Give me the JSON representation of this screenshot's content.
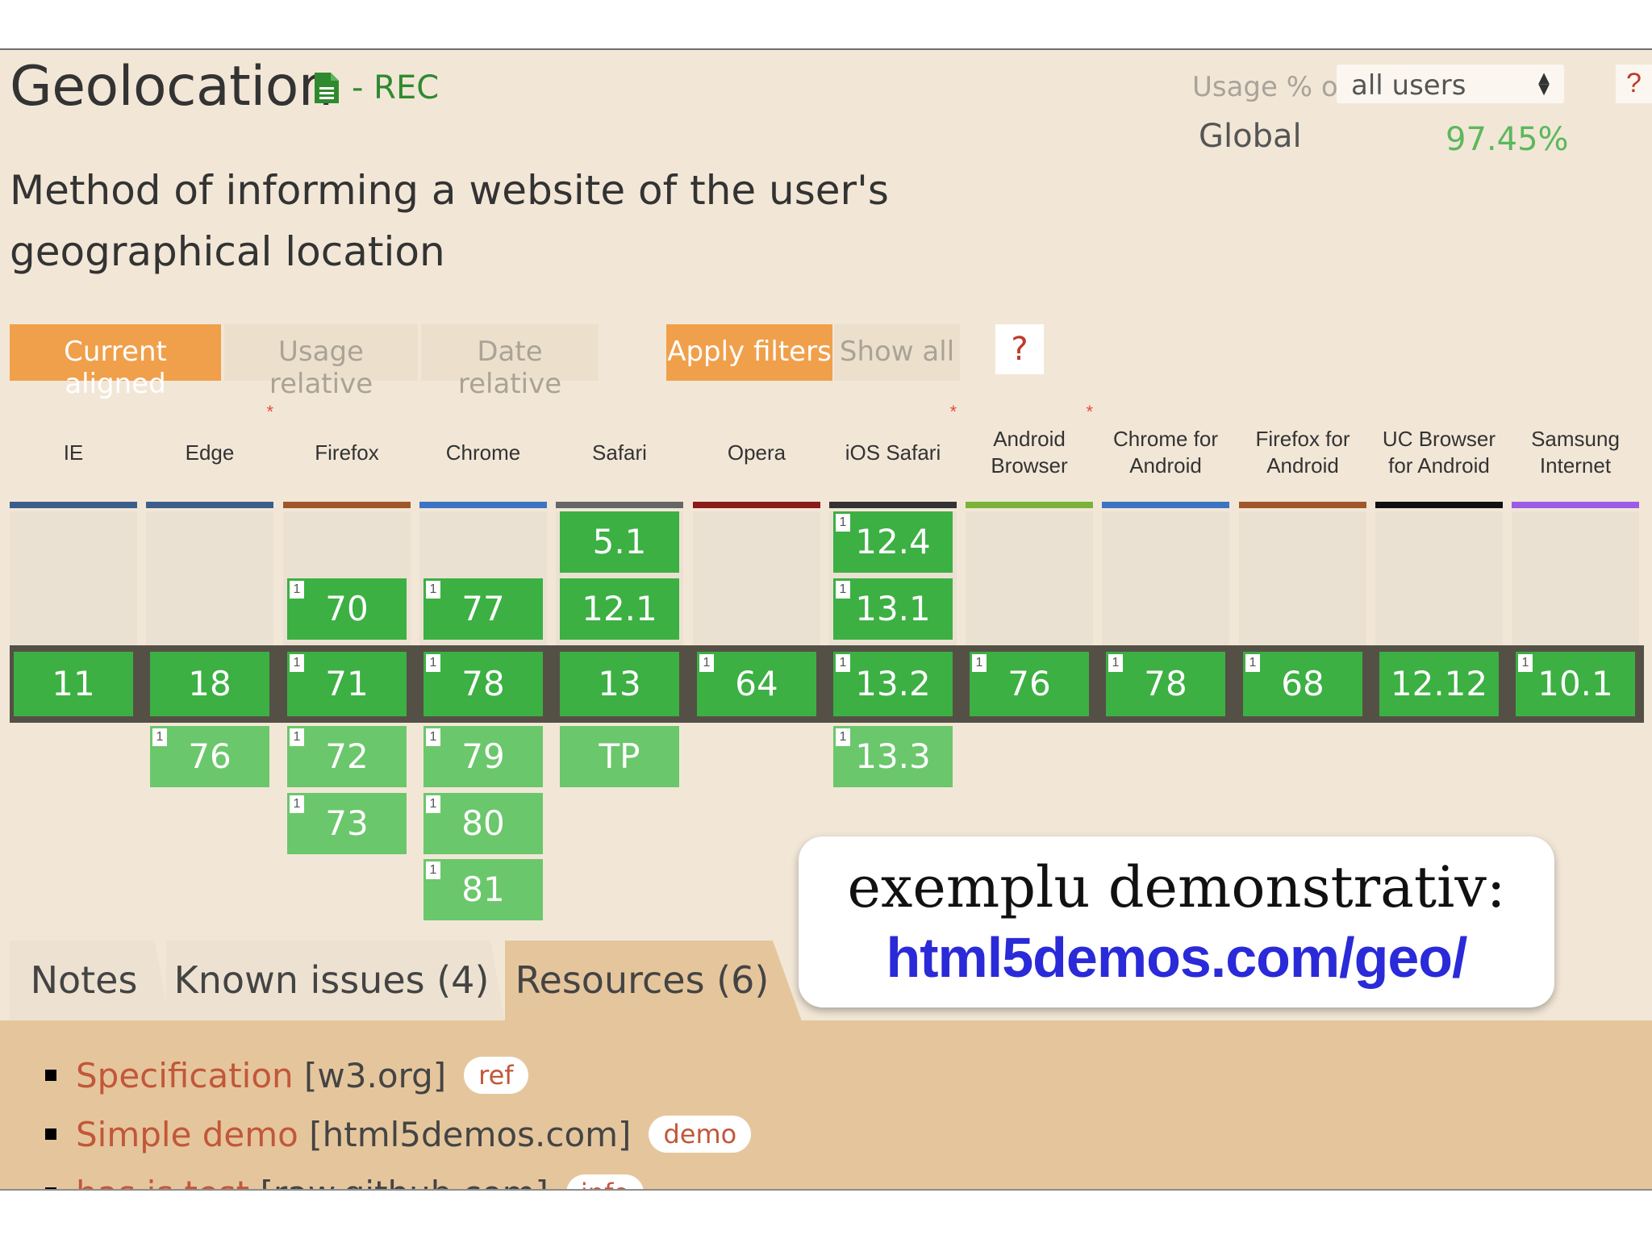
{
  "feature": {
    "title": "Geolocation",
    "status": "- REC",
    "description": "Method of informing a website of the user's geographical location"
  },
  "usage": {
    "label": "Usage % of",
    "select_value": "all users",
    "help": "?",
    "global_label": "Global",
    "global_value": "97.45%"
  },
  "toolbar": {
    "current_aligned": "Current aligned",
    "usage_relative": "Usage relative",
    "date_relative": "Date relative",
    "apply_filters": "Apply filters",
    "show_all": "Show all",
    "help": "?"
  },
  "browsers": [
    {
      "name": "IE",
      "star": false,
      "bar_color": "#3b5f8a",
      "prev": [],
      "current": {
        "v": "11",
        "note": ""
      },
      "future": []
    },
    {
      "name": "Edge",
      "star": true,
      "bar_color": "#3b5f8a",
      "prev": [],
      "current": {
        "v": "18",
        "note": ""
      },
      "future": [
        {
          "v": "76",
          "note": "1"
        }
      ]
    },
    {
      "name": "Firefox",
      "star": false,
      "bar_color": "#a0582a",
      "prev": [
        {
          "v": "70",
          "note": "1"
        }
      ],
      "current": {
        "v": "71",
        "note": "1"
      },
      "future": [
        {
          "v": "72",
          "note": "1"
        },
        {
          "v": "73",
          "note": "1"
        }
      ]
    },
    {
      "name": "Chrome",
      "star": false,
      "bar_color": "#3d73c4",
      "prev": [
        {
          "v": "77",
          "note": "1"
        }
      ],
      "current": {
        "v": "78",
        "note": "1"
      },
      "future": [
        {
          "v": "79",
          "note": "1"
        },
        {
          "v": "80",
          "note": "1"
        },
        {
          "v": "81",
          "note": "1"
        }
      ]
    },
    {
      "name": "Safari",
      "star": false,
      "bar_color": "#666666",
      "prev": [
        {
          "v": "5.1",
          "note": ""
        },
        {
          "v": "12.1",
          "note": ""
        }
      ],
      "current": {
        "v": "13",
        "note": ""
      },
      "future": [
        {
          "v": "TP",
          "note": ""
        }
      ]
    },
    {
      "name": "Opera",
      "star": false,
      "bar_color": "#8b1a1a",
      "prev": [],
      "current": {
        "v": "64",
        "note": "1"
      },
      "future": []
    },
    {
      "name": "iOS Safari",
      "star": true,
      "bar_color": "#333333",
      "prev": [
        {
          "v": "12.4",
          "note": "1"
        },
        {
          "v": "13.1",
          "note": "1"
        }
      ],
      "current": {
        "v": "13.2",
        "note": "1"
      },
      "future": [
        {
          "v": "13.3",
          "note": "1"
        }
      ]
    },
    {
      "name": "Android Browser",
      "star": true,
      "bar_color": "#7ab23a",
      "prev": [],
      "current": {
        "v": "76",
        "note": "1"
      },
      "future": []
    },
    {
      "name": "Chrome for Android",
      "star": false,
      "bar_color": "#3d73c4",
      "prev": [],
      "current": {
        "v": "78",
        "note": "1"
      },
      "future": []
    },
    {
      "name": "Firefox for Android",
      "star": false,
      "bar_color": "#a0582a",
      "prev": [],
      "current": {
        "v": "68",
        "note": "1"
      },
      "future": []
    },
    {
      "name": "UC Browser for Android",
      "star": false,
      "bar_color": "#111111",
      "prev": [],
      "current": {
        "v": "12.12",
        "note": ""
      },
      "future": []
    },
    {
      "name": "Samsung Internet",
      "star": false,
      "bar_color": "#9b5de5",
      "prev": [],
      "current": {
        "v": "10.1",
        "note": "1"
      },
      "future": []
    }
  ],
  "tabs": {
    "notes": "Notes",
    "known_issues": "Known issues (4)",
    "resources": "Resources (6)"
  },
  "resources": [
    {
      "link": "Specification",
      "source": "[w3.org]",
      "badge": "ref"
    },
    {
      "link": "Simple demo",
      "source": "[html5demos.com]",
      "badge": "demo"
    },
    {
      "link": "has.js test",
      "source": "[raw.github.com]",
      "badge": "info"
    }
  ],
  "overlay": {
    "line1": "exemplu demonstrativ:",
    "line2": "html5demos.com/geo/"
  },
  "colors": {
    "background": "#f2e7d7",
    "supported": "#3cb043",
    "supported_future": "#6bc76b",
    "accent_orange": "#f0a04b",
    "link": "#c2573a",
    "overlay_link": "#2a2ad8"
  }
}
